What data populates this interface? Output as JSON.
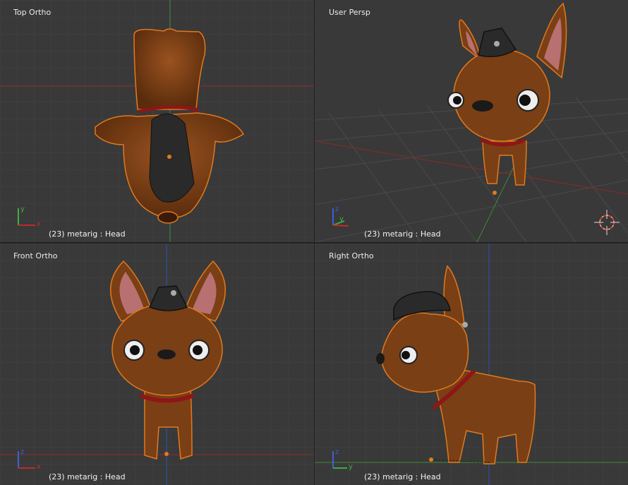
{
  "viewports": [
    {
      "label": "Top Ortho",
      "status": "(23) metarig : Head",
      "axes": [
        "y",
        "x"
      ]
    },
    {
      "label": "User Persp",
      "status": "(23) metarig : Head",
      "axes": [
        "z",
        "y"
      ]
    },
    {
      "label": "Front Ortho",
      "status": "(23) metarig : Head",
      "axes": [
        "z",
        "x"
      ]
    },
    {
      "label": "Right Ortho",
      "status": "(23) metarig : Head",
      "axes": [
        "z",
        "y"
      ]
    }
  ],
  "colors": {
    "viewport_bg": "#393939",
    "fur": "#7a3f15",
    "outline": "#e07a1e",
    "collar": "#8e1616",
    "hat": "#2a2a2a",
    "axis_x": "#c02a2a",
    "axis_y": "#3fae3f",
    "axis_z": "#3c5ed8"
  }
}
